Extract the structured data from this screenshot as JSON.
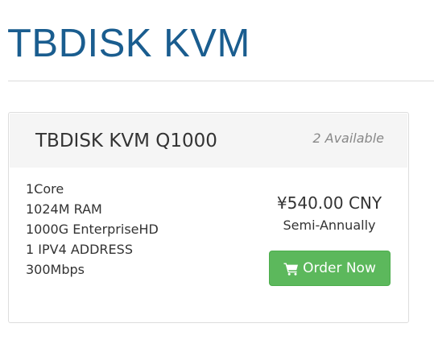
{
  "page": {
    "title": "TBDISK KVM"
  },
  "product": {
    "name": "TBDISK KVM Q1000",
    "availability": "2 Available",
    "features": [
      "1Core",
      "1024M RAM",
      "1000G EnterpriseHD",
      "1 IPV4 ADDRESS",
      "300Mbps"
    ],
    "price": "¥540.00 CNY",
    "billing_cycle": "Semi-Annually",
    "order_button": {
      "label": "Order Now",
      "icon": "shopping-cart-icon",
      "color": "#5cb85c"
    }
  },
  "colors": {
    "title": "#1a5d8f",
    "header_bg": "#f5f5f5",
    "text": "#333333"
  }
}
